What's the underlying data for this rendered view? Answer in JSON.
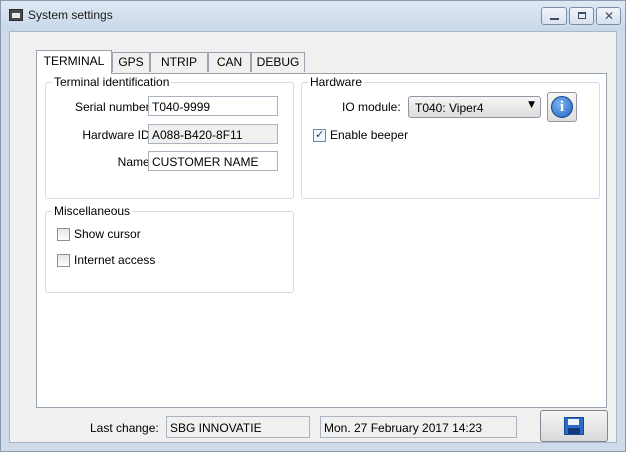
{
  "window": {
    "title": "System settings"
  },
  "tabs": [
    "TERMINAL",
    "GPS",
    "NTRIP",
    "CAN",
    "DEBUG"
  ],
  "terminal_identification": {
    "legend": "Terminal identification",
    "serial_number_label": "Serial number:",
    "serial_number_value": "T040-9999",
    "hardware_id_label": "Hardware ID:",
    "hardware_id_value": "A088-B420-8F11",
    "name_label": "Name:",
    "name_value": "CUSTOMER NAME"
  },
  "hardware": {
    "legend": "Hardware",
    "io_module_label": "IO module:",
    "io_module_selected": "T040: Viper4",
    "enable_beeper_label": "Enable beeper",
    "enable_beeper_checked": true
  },
  "miscellaneous": {
    "legend": "Miscellaneous",
    "show_cursor_label": "Show cursor",
    "show_cursor_checked": false,
    "internet_access_label": "Internet access",
    "internet_access_checked": false
  },
  "footer": {
    "last_change_label": "Last change:",
    "changed_by": "SBG INNOVATIE",
    "changed_on": "Mon. 27 February 2017 14:23"
  },
  "icons": {
    "app": "window-icon",
    "info": "info-icon",
    "save": "floppy-disk-icon",
    "checkmark": "✓",
    "dropdown_arrow": "▼",
    "close": "✕"
  },
  "colors": {
    "title_bar": "#c9d7e8",
    "dialog_background": "#f0f0f0",
    "info_blue": "#1f63c4",
    "save_blue": "#2d6bc9"
  }
}
